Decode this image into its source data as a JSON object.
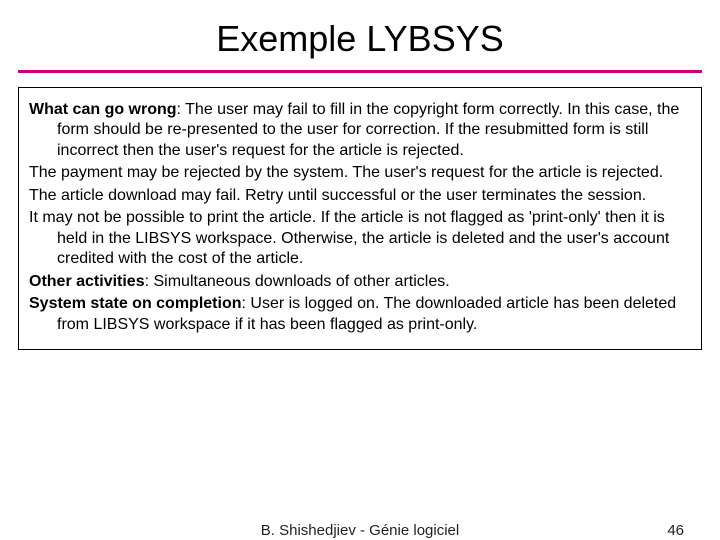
{
  "title": "Exemple LYBSYS",
  "sections": [
    {
      "lead": "What can go wrong",
      "text": ": The user may fail to fill in the copyright form correctly. In this case, the form should be re-presented  to the user for correction. If the resubmitted form is still incorrect then the user's request for the article is rejected."
    },
    {
      "lead": "",
      "text": "The payment may be rejected by the system. The user's request for the article is rejected."
    },
    {
      "lead": "",
      "text": "The article download may fail. Retry until successful or the user terminates the session."
    },
    {
      "lead": "",
      "text": "It may not be possible to print the article. If the article is not flagged as 'print-only' then it is held in the LIBSYS workspace. Otherwise, the article is deleted and the user's account credited with the cost of the article."
    },
    {
      "lead": "Other activities",
      "text": ": Simultaneous downloads of other articles."
    },
    {
      "lead": "System state on completion",
      "text": ": User is logged on. The downloaded article has been deleted from LIBSYS workspace if it has been flagged as print-only."
    }
  ],
  "footer": {
    "author": "B. Shishedjiev - Génie logiciel",
    "page": "46"
  }
}
